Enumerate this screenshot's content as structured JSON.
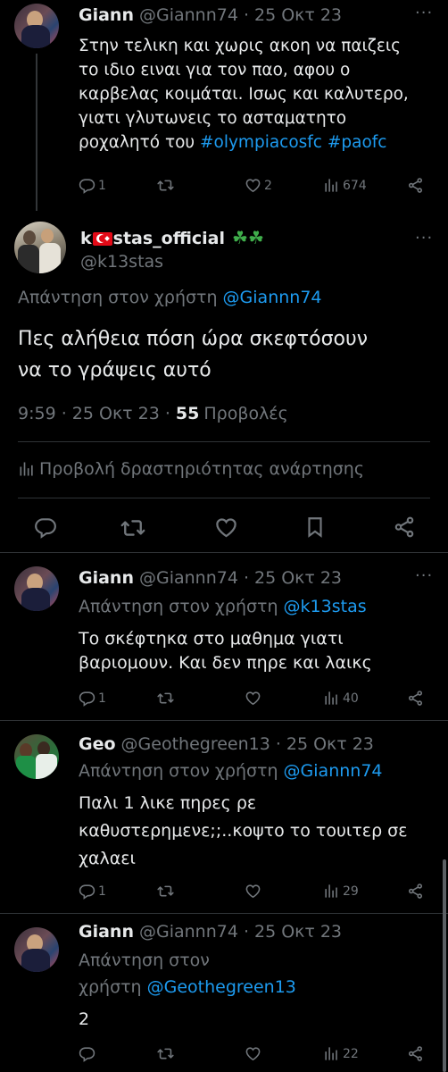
{
  "tweets": {
    "t1": {
      "name": "Giann",
      "handle": "@Giannn74",
      "dot": "·",
      "date": "25 Οκτ 23",
      "text": "Στην τελικη και χωρις ακοη να παιζεις\nτο ιδιο ειναι για τον παο, αφου ο\nκαρβελας κοιμάται. Ισως και καλυτερο,\nγιατι γλυτωνεις το ασταματητο\nροχαλητό του",
      "hashtag1": "#olympiacosfc",
      "hashtag2": "#paofc",
      "replies": "1",
      "retweets": "",
      "likes": "2",
      "views": "674"
    },
    "main": {
      "name_prefix": "k",
      "flag": "🇹🇷",
      "name_suffix": "stas_official",
      "emoji": "☘☘",
      "handle": "@k13stas",
      "reply_label": "Απάντηση στον χρήστη",
      "reply_to": "@Giannn74",
      "text": "Πες αλήθεια πόση ώρα  σκεφτόσουν\nνα το γράψεις αυτό",
      "time": "9:59 · 25 Οκτ 23 ·",
      "views_count": "55",
      "views_label": "Προβολές",
      "activity": "Προβολή δραστηριότητας ανάρτησης"
    },
    "t3": {
      "name": "Giann",
      "handle": "@Giannn74",
      "dot": "·",
      "date": "25 Οκτ 23",
      "reply_label": "Απάντηση στον χρήστη",
      "reply_to": "@k13stas",
      "text": "Το σκέφτηκα στο μαθημα γιατι\nβαριομουν. Και δεν πηρε και λαικς",
      "replies": "1",
      "views": "40"
    },
    "t4": {
      "name": "Geo",
      "handle": "@Geothegreen13",
      "dot": "·",
      "date": "25 Οκτ 23",
      "reply_label": "Απάντηση στον χρήστη",
      "reply_to": "@Giannn74",
      "text": "Παλι 1 λικε πηρες ρε\nκαθυστερημενε;;..κοψτο το τουιτερ σε\nχαλαει",
      "replies": "1",
      "views": "29"
    },
    "t5": {
      "name": "Giann",
      "handle": "@Giannn74",
      "dot": "·",
      "date": "25 Οκτ 23",
      "reply_label_1": "Απάντηση στον",
      "reply_label_2": "χρήστη",
      "reply_to": "@Geothegreen13",
      "text": "2",
      "views": "22"
    }
  },
  "icons": {
    "reply": "reply-icon",
    "retweet": "retweet-icon",
    "like": "heart-icon",
    "views": "views-icon",
    "share": "share-icon",
    "bookmark": "bookmark-icon",
    "more": "more-icon"
  },
  "colors": {
    "background": "#000000",
    "text": "#e7e9ea",
    "muted": "#71767b",
    "link": "#1d9bf0",
    "divider": "#2f3336"
  }
}
